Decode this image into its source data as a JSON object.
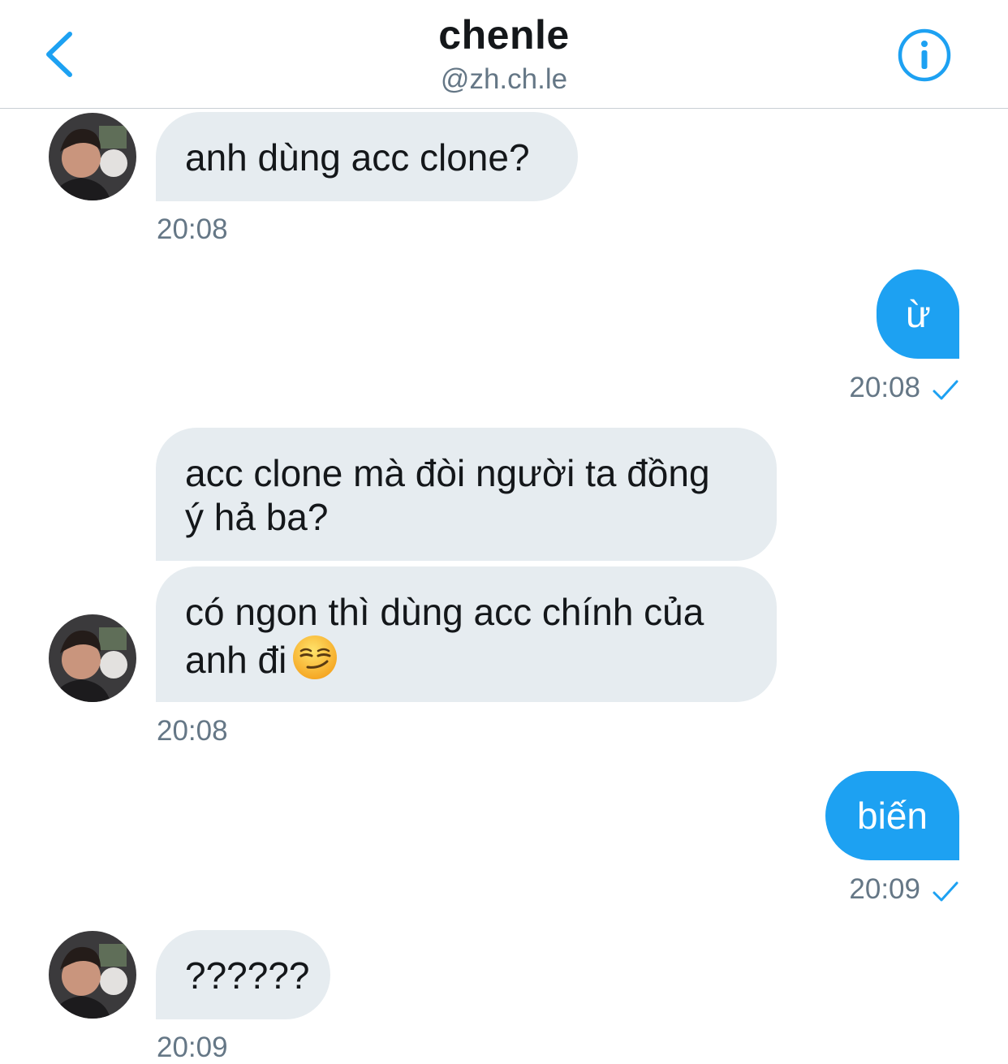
{
  "header": {
    "title": "chenle",
    "handle": "@zh.ch.le",
    "back_icon": "chevron-left-icon",
    "info_icon": "info-circle-icon"
  },
  "colors": {
    "accent": "#1da1f2",
    "incoming_bubble": "#e6ecf0",
    "muted_text": "#657786"
  },
  "messages": [
    {
      "direction": "incoming",
      "text": "anh dùng acc clone?",
      "time": "20:08"
    },
    {
      "direction": "outgoing",
      "text": "ừ",
      "time": "20:08",
      "status_icon": "checkmark-icon"
    },
    {
      "direction": "incoming",
      "text": "acc clone mà đòi người ta đồng\ný hả ba?"
    },
    {
      "direction": "incoming",
      "text": "có ngon thì dùng acc chính của\nanh đi",
      "emoji": "smirking-face-emoji",
      "time": "20:08"
    },
    {
      "direction": "outgoing",
      "text": "biến",
      "time": "20:09",
      "status_icon": "checkmark-icon"
    },
    {
      "direction": "incoming",
      "text": "??????",
      "time": "20:09"
    }
  ]
}
